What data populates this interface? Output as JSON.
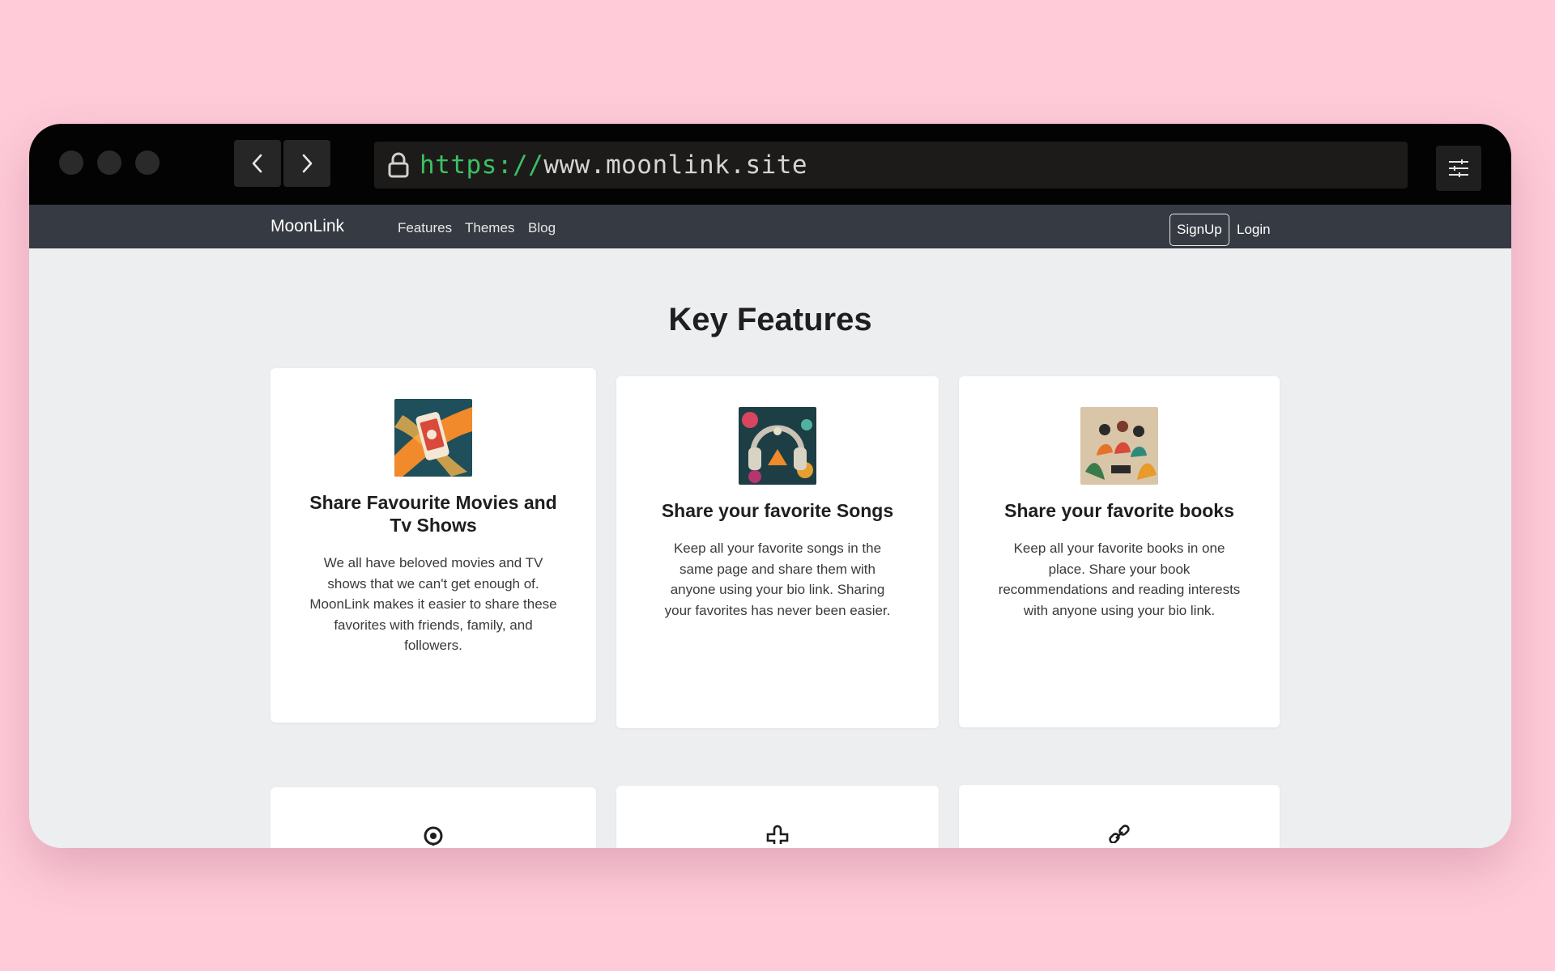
{
  "browser": {
    "url_protocol": "https://",
    "url_host": "www.moonlink.site",
    "icons": {
      "back": "chevron-left-icon",
      "forward": "chevron-right-icon",
      "lock": "lock-icon",
      "settings": "sliders-icon"
    }
  },
  "nav": {
    "brand": "MoonLink",
    "links": [
      "Features",
      "Themes",
      "Blog"
    ],
    "signup": "SignUp",
    "login": "Login"
  },
  "section": {
    "heading": "Key Features"
  },
  "cards": [
    {
      "title": "Share Favourite Movies and Tv Shows",
      "text": "We all have beloved movies and TV shows that we can't get enough of. MoonLink makes it easier to share these favorites with friends, family, and followers.",
      "image": "movies-phone-illustration"
    },
    {
      "title": "Share your favorite Songs",
      "text": "Keep all your favorite songs in the same page and share them with anyone using your bio link. Sharing your favorites has never been easier.",
      "image": "headphones-illustration"
    },
    {
      "title": "Share your favorite books",
      "text": "Keep all your favorite books in one place. Share your book recommendations and reading interests with anyone using your bio link.",
      "image": "readers-illustration"
    }
  ],
  "lower_cards_icons": [
    "podcast-icon",
    "puzzle-icon",
    "link-icon"
  ],
  "colors": {
    "page_background": "#ffcbd9",
    "titlebar": "#030303",
    "navbar": "#363a42",
    "content_background": "#edeef0",
    "url_protocol": "#3cc062"
  }
}
